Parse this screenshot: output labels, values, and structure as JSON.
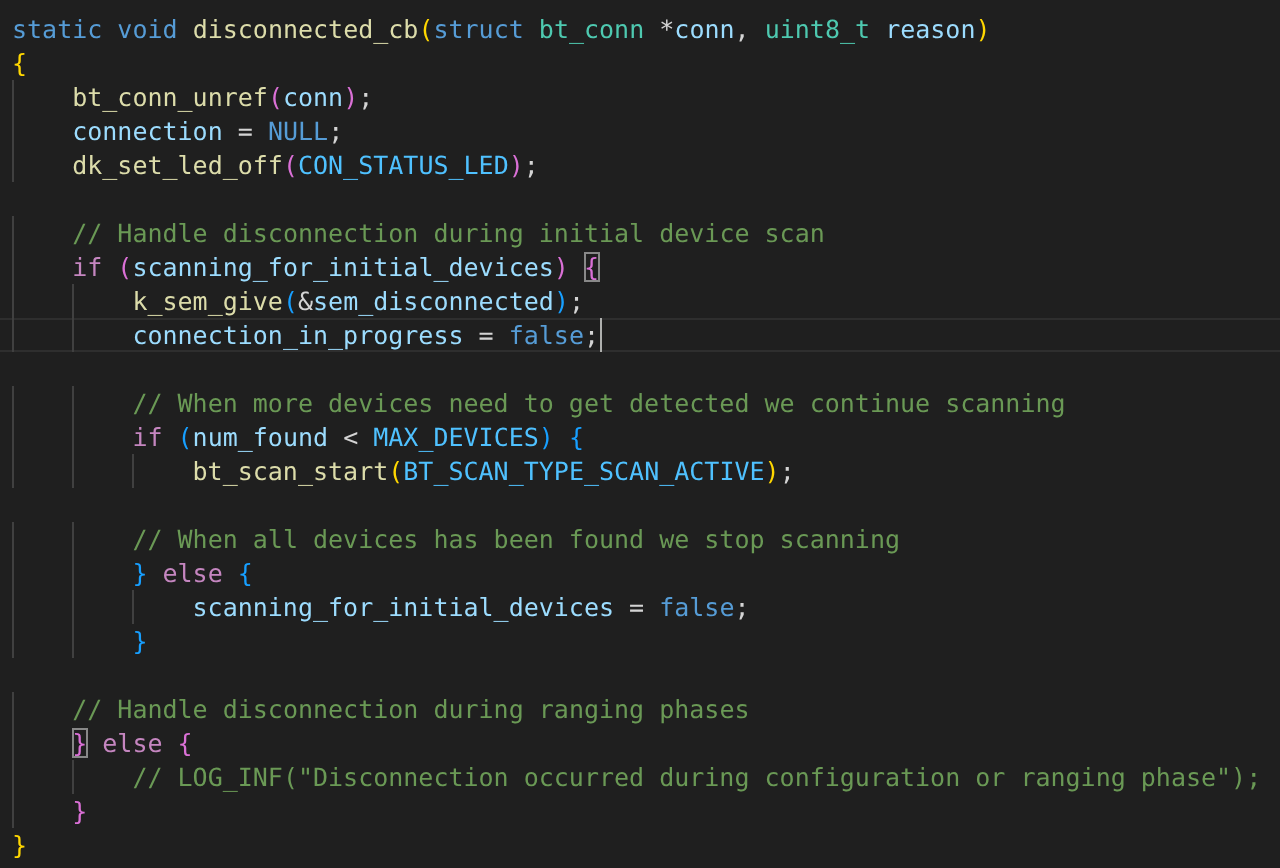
{
  "editor": {
    "lines": [
      {
        "kind": "code",
        "current": false,
        "tokens": [
          {
            "kind": "kw",
            "text": "static void "
          },
          {
            "kind": "fn",
            "text": "disconnected_cb"
          },
          {
            "kind": "b1",
            "text": "(",
            "matched": false
          },
          {
            "kind": "kw",
            "text": "struct "
          },
          {
            "kind": "type",
            "text": "bt_conn "
          },
          {
            "kind": "p",
            "text": "*"
          },
          {
            "kind": "var",
            "text": "conn"
          },
          {
            "kind": "p",
            "text": ", "
          },
          {
            "kind": "type",
            "text": "uint8_t "
          },
          {
            "kind": "var",
            "text": "reason"
          },
          {
            "kind": "b1",
            "text": ")",
            "matched": false
          }
        ]
      },
      {
        "kind": "code",
        "current": false,
        "tokens": [
          {
            "kind": "b1",
            "text": "{",
            "matched": false
          }
        ],
        "children": [
          {
            "kind": "code",
            "current": false,
            "tokens": [
              {
                "kind": "fn",
                "text": "bt_conn_unref"
              },
              {
                "kind": "b2",
                "text": "(",
                "matched": false
              },
              {
                "kind": "var",
                "text": "conn"
              },
              {
                "kind": "b2",
                "text": ")",
                "matched": false
              },
              {
                "kind": "p",
                "text": ";"
              }
            ]
          },
          {
            "kind": "code",
            "current": false,
            "tokens": [
              {
                "kind": "var",
                "text": "connection "
              },
              {
                "kind": "p",
                "text": "= "
              },
              {
                "kind": "kw",
                "text": "NULL"
              },
              {
                "kind": "p",
                "text": ";"
              }
            ]
          },
          {
            "kind": "code",
            "current": false,
            "tokens": [
              {
                "kind": "fn",
                "text": "dk_set_led_off"
              },
              {
                "kind": "b2",
                "text": "(",
                "matched": false
              },
              {
                "kind": "const",
                "text": "CON_STATUS_LED"
              },
              {
                "kind": "b2",
                "text": ")",
                "matched": false
              },
              {
                "kind": "p",
                "text": ";"
              }
            ]
          },
          {
            "kind": "blank",
            "current": false
          },
          {
            "kind": "code",
            "current": false,
            "tokens": [
              {
                "kind": "comment",
                "text": "// Handle disconnection during initial device scan"
              }
            ]
          },
          {
            "kind": "code",
            "current": false,
            "tokens": [
              {
                "kind": "ctrl",
                "text": "if "
              },
              {
                "kind": "b2",
                "text": "(",
                "matched": false
              },
              {
                "kind": "var",
                "text": "scanning_for_initial_devices"
              },
              {
                "kind": "b2",
                "text": ") ",
                "matched": false
              },
              {
                "kind": "b2",
                "text": "{",
                "matched": true
              }
            ],
            "children": [
              {
                "kind": "code",
                "current": false,
                "tokens": [
                  {
                    "kind": "fn",
                    "text": "k_sem_give"
                  },
                  {
                    "kind": "b3",
                    "text": "(",
                    "matched": false
                  },
                  {
                    "kind": "p",
                    "text": "&"
                  },
                  {
                    "kind": "var",
                    "text": "sem_disconnected"
                  },
                  {
                    "kind": "b3",
                    "text": ")",
                    "matched": false
                  },
                  {
                    "kind": "p",
                    "text": ";"
                  }
                ]
              },
              {
                "kind": "code",
                "current": true,
                "tokens": [
                  {
                    "kind": "var",
                    "text": "connection_in_progress "
                  },
                  {
                    "kind": "p",
                    "text": "= "
                  },
                  {
                    "kind": "kw",
                    "text": "false"
                  },
                  {
                    "kind": "p",
                    "text": ";"
                  }
                ]
              },
              {
                "kind": "blank",
                "current": false
              },
              {
                "kind": "code",
                "current": false,
                "tokens": [
                  {
                    "kind": "comment",
                    "text": "// When more devices need to get detected we continue scanning"
                  }
                ]
              },
              {
                "kind": "code",
                "current": false,
                "tokens": [
                  {
                    "kind": "ctrl",
                    "text": "if "
                  },
                  {
                    "kind": "b3",
                    "text": "(",
                    "matched": false
                  },
                  {
                    "kind": "var",
                    "text": "num_found "
                  },
                  {
                    "kind": "p",
                    "text": "< "
                  },
                  {
                    "kind": "const",
                    "text": "MAX_DEVICES"
                  },
                  {
                    "kind": "b3",
                    "text": ") ",
                    "matched": false
                  },
                  {
                    "kind": "b3",
                    "text": "{",
                    "matched": false
                  }
                ],
                "children": [
                  {
                    "kind": "code",
                    "current": false,
                    "tokens": [
                      {
                        "kind": "fn",
                        "text": "bt_scan_start"
                      },
                      {
                        "kind": "b1",
                        "text": "(",
                        "matched": false
                      },
                      {
                        "kind": "const",
                        "text": "BT_SCAN_TYPE_SCAN_ACTIVE"
                      },
                      {
                        "kind": "b1",
                        "text": ")",
                        "matched": false
                      },
                      {
                        "kind": "p",
                        "text": ";"
                      }
                    ]
                  },
                  {
                    "kind": "blank",
                    "current": false
                  }
                ]
              },
              {
                "kind": "code",
                "current": false,
                "tokens": [
                  {
                    "kind": "comment",
                    "text": "// When all devices has been found we stop scanning"
                  }
                ]
              },
              {
                "kind": "code",
                "current": false,
                "tokens": [
                  {
                    "kind": "b3",
                    "text": "}",
                    "matched": false
                  },
                  {
                    "kind": "ctrl",
                    "text": " else "
                  },
                  {
                    "kind": "b3",
                    "text": "{",
                    "matched": false
                  }
                ],
                "children": [
                  {
                    "kind": "code",
                    "current": false,
                    "tokens": [
                      {
                        "kind": "var",
                        "text": "scanning_for_initial_devices "
                      },
                      {
                        "kind": "p",
                        "text": "= "
                      },
                      {
                        "kind": "kw",
                        "text": "false"
                      },
                      {
                        "kind": "p",
                        "text": ";"
                      }
                    ]
                  }
                ]
              },
              {
                "kind": "code",
                "current": false,
                "tokens": [
                  {
                    "kind": "b3",
                    "text": "}",
                    "matched": false
                  }
                ]
              },
              {
                "kind": "blank",
                "current": false
              }
            ]
          },
          {
            "kind": "code",
            "current": false,
            "tokens": [
              {
                "kind": "comment",
                "text": "// Handle disconnection during ranging phases"
              }
            ]
          },
          {
            "kind": "code",
            "current": false,
            "tokens": [
              {
                "kind": "b2",
                "text": "}",
                "matched": true
              },
              {
                "kind": "ctrl",
                "text": " else "
              },
              {
                "kind": "b2",
                "text": "{",
                "matched": false
              }
            ],
            "children": [
              {
                "kind": "code",
                "current": false,
                "tokens": [
                  {
                    "kind": "comment",
                    "text": "// LOG_INF(\"Disconnection occurred during configuration or ranging phase\");"
                  }
                ]
              }
            ]
          },
          {
            "kind": "code",
            "current": false,
            "tokens": [
              {
                "kind": "b2",
                "text": "}",
                "matched": false
              }
            ]
          }
        ]
      },
      {
        "kind": "code",
        "current": false,
        "tokens": [
          {
            "kind": "b1",
            "text": "}",
            "matched": false
          }
        ]
      }
    ]
  }
}
